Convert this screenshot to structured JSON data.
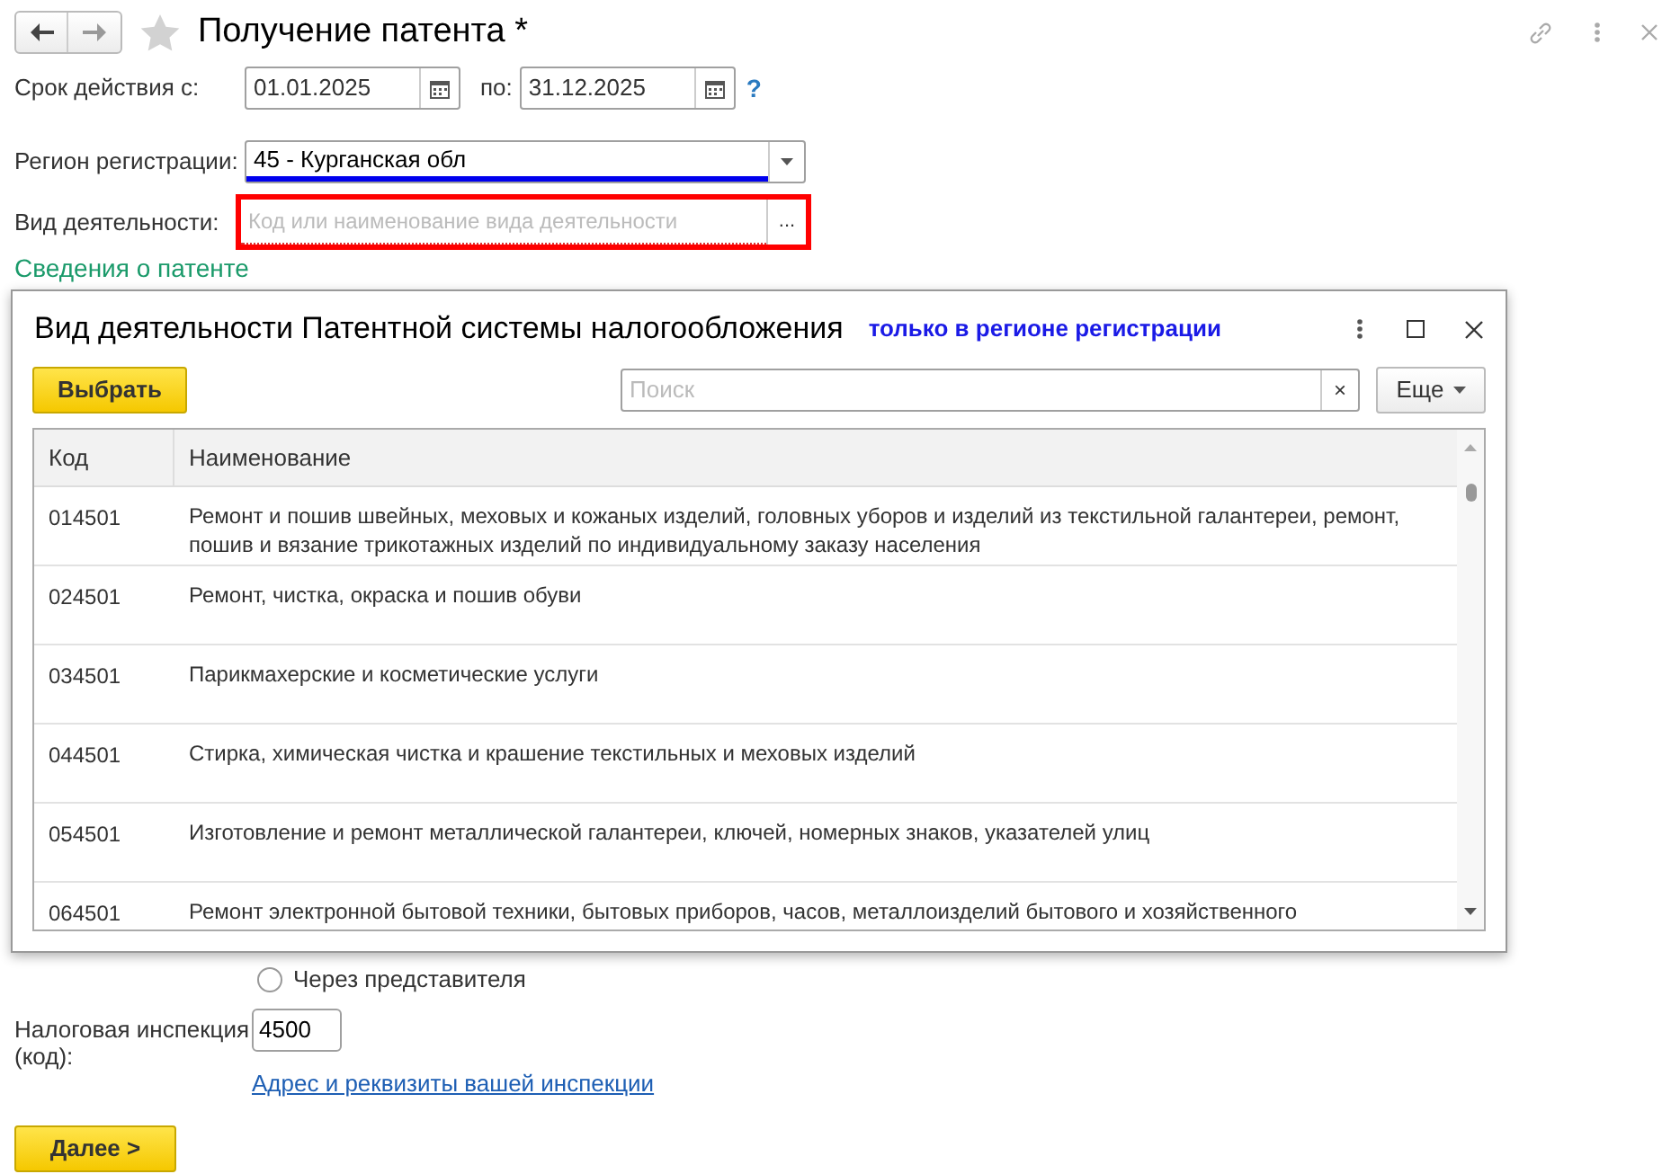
{
  "window": {
    "title": "Получение патента *",
    "favorite": false
  },
  "period": {
    "from_label": "Срок действия с:",
    "from_value": "01.01.2025",
    "to_label": "по:",
    "to_value": "31.12.2025",
    "help": "?"
  },
  "region": {
    "label": "Регион регистрации:",
    "value": "45 - Курганская обл"
  },
  "activity": {
    "label": "Вид деятельности:",
    "placeholder": "Код или наименование вида деятельности",
    "button": "..."
  },
  "section_title": "Сведения о патенте",
  "dialog": {
    "title": "Вид деятельности Патентной системы налогообложения",
    "filter_link": "только в регионе регистрации",
    "select_button": "Выбрать",
    "search_placeholder": "Поиск",
    "clear": "×",
    "more_button": "Еще",
    "columns": [
      "Код",
      "Наименование"
    ],
    "rows": [
      {
        "code": "014501",
        "name": "Ремонт и пошив швейных, меховых и кожаных изделий, головных уборов и изделий из текстильной галантереи, ремонт, пошив и вязание трикотажных изделий по индивидуальному заказу населения"
      },
      {
        "code": "024501",
        "name": "Ремонт, чистка, окраска и пошив обуви"
      },
      {
        "code": "034501",
        "name": "Парикмахерские и косметические услуги"
      },
      {
        "code": "044501",
        "name": "Стирка, химическая чистка и крашение текстильных и меховых изделий"
      },
      {
        "code": "054501",
        "name": "Изготовление и ремонт металлической галантереи, ключей, номерных знаков, указателей улиц"
      },
      {
        "code": "064501",
        "name": "Ремонт электронной бытовой техники, бытовых приборов, часов, металлоизделий бытового и хозяйственного"
      }
    ]
  },
  "representative": {
    "label": "Через представителя",
    "checked": false
  },
  "inspection": {
    "label": "Налоговая инспекция (код):",
    "value": "4500",
    "link": "Адрес и реквизиты вашей инспекции"
  },
  "next_button": "Далее >"
}
